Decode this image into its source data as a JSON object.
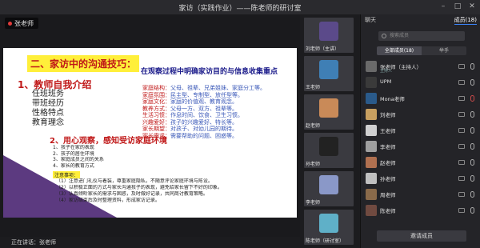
{
  "window": {
    "title": "家访（实践作业）——陈老师的研讨室"
  },
  "stage": {
    "speaker_name": "张老师",
    "slide": {
      "title": "二、家访中的沟通技巧：",
      "subtitle": "在观察过程中明确家访目的与信息收集重点",
      "section1_heading": "1、教师自我介绍",
      "section1_lines": [
        "任班班务",
        "带班经历",
        "性格特点",
        "教育理念"
      ],
      "factors": [
        {
          "k": "家庭结构：",
          "v": "父母、祖辈、兄弟姐妹、家庭分工等。"
        },
        {
          "k": "家庭氛围：",
          "v": "民主型、专制型、放任型等。"
        },
        {
          "k": "家庭文化：",
          "v": "家庭的价值观、教育观念。"
        },
        {
          "k": "教养方式：",
          "v": "父母一方、双方、祖辈等。"
        },
        {
          "k": "生活习惯：",
          "v": "作息时间、饮食、卫生习惯。"
        },
        {
          "k": "兴趣爱好：",
          "v": "孩子的兴趣爱好、特长等。"
        },
        {
          "k": "家长期望：",
          "v": "对孩子、对幼儿园的期待。"
        },
        {
          "k": "家长需求：",
          "v": "需要帮助的问题、困惑等。"
        }
      ],
      "section2_heading": "2、用心观察，感知受访家庭环境",
      "section2_lines": [
        "1、孩子在家的表现",
        "2、孩子的居住环境",
        "3、家庭成员之间的关系",
        "4、家长的教育方式"
      ],
      "highlight_label": "注意事项：",
      "long_lines": [
        "（1）注意进门礼仪与着装，尊重家庭隐私，不随意评论家庭环境与陈设。",
        "（2）以积极正面的方式与家长沟通孩子的表现，避免给家长留下不好的印象。",
        "（3）认真倾听家长的需求与困惑，及时做好记录，共同商讨教育策略。",
        "（4）家访结束后及时整理资料，形成家访记录。"
      ]
    }
  },
  "participants_strip": [
    {
      "name": "刘老师（主讲）",
      "color": "#5b4a8a"
    },
    {
      "name": "王老师",
      "color": "#3f7fb5"
    },
    {
      "name": "赵老师",
      "color": "#c98a58"
    },
    {
      "name": "孙老师",
      "color": "#222222"
    },
    {
      "name": "李老师",
      "color": "#8a98c8"
    },
    {
      "name": "陈老师（研讨室）",
      "color": "#5fb0c8"
    }
  ],
  "panel": {
    "tabs": [
      "聊天",
      "成员(18)"
    ],
    "active_tab": 1,
    "search_placeholder": "搜索成员",
    "segments": [
      "全部成员(18)",
      "举手"
    ],
    "members": [
      {
        "name": "张老师（主持人）",
        "sub": "主持人",
        "color": "#6a6a6a",
        "mic_off": false
      },
      {
        "name": "UPM",
        "sub": "",
        "color": "#3a3a3a",
        "mic_off": false
      },
      {
        "name": "Mona老师",
        "sub": "",
        "color": "#2a5a8a",
        "mic_off": true
      },
      {
        "name": "刘老师",
        "sub": "",
        "color": "#c8a060",
        "mic_off": false
      },
      {
        "name": "王老师",
        "sub": "",
        "color": "#d0d0d0",
        "mic_off": false
      },
      {
        "name": "李老师",
        "sub": "",
        "color": "#a0a0a0",
        "mic_off": false
      },
      {
        "name": "赵老师",
        "sub": "",
        "color": "#b07050",
        "mic_off": false
      },
      {
        "name": "孙老师",
        "sub": "",
        "color": "#c0c0c0",
        "mic_off": false
      },
      {
        "name": "周老师",
        "sub": "",
        "color": "#8a6a4a",
        "mic_off": false
      },
      {
        "name": "陈老师",
        "sub": "",
        "color": "#704a40",
        "mic_off": false
      },
      {
        "name": "黄老师",
        "sub": "",
        "color": "#9a9a9a",
        "mic_off": false
      }
    ],
    "bottom_button": "邀请成员"
  },
  "status": {
    "text": "正在讲话：张老师"
  }
}
